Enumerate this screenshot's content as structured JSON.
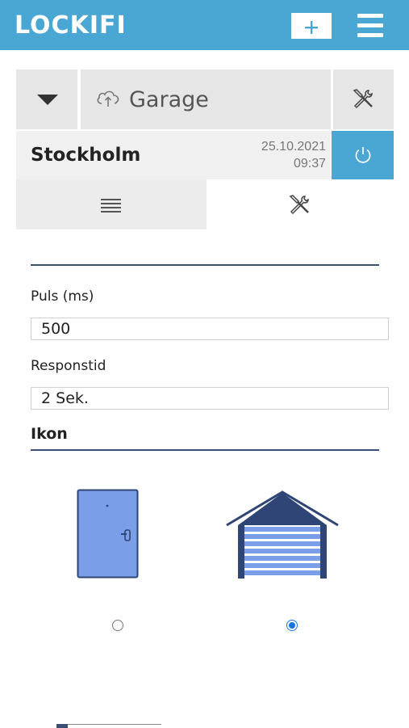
{
  "app": {
    "logo": "LOCKIFI"
  },
  "topbar": {
    "add_icon": "plus-icon",
    "menu_icon": "hamburger-icon"
  },
  "device": {
    "name": "Garage",
    "cloud_icon": "cloud-upload-icon",
    "dropdown_icon": "triangle-down-icon",
    "tools_icon": "tools-icon"
  },
  "location": {
    "name": "Stockholm",
    "date": "25.10.2021",
    "time": "09:37",
    "power_icon": "power-icon"
  },
  "tabs": [
    {
      "icon": "list-icon",
      "active": false
    },
    {
      "icon": "tools-icon",
      "active": true
    }
  ],
  "settings": {
    "puls_label": "Puls (ms)",
    "puls_value": "500",
    "respons_label": "Responstid",
    "respons_value": "2 Sek.",
    "icon_section_title": "Ikon",
    "icon_options": [
      {
        "icon": "door-icon",
        "selected": false
      },
      {
        "icon": "garage-icon",
        "selected": true
      }
    ]
  },
  "colors": {
    "brand": "#4aa6d2",
    "navy": "#3b4f73",
    "door_fill": "#7b9ee8",
    "garage_roof": "#2f4576",
    "radio_selected": "#1a73e8"
  }
}
